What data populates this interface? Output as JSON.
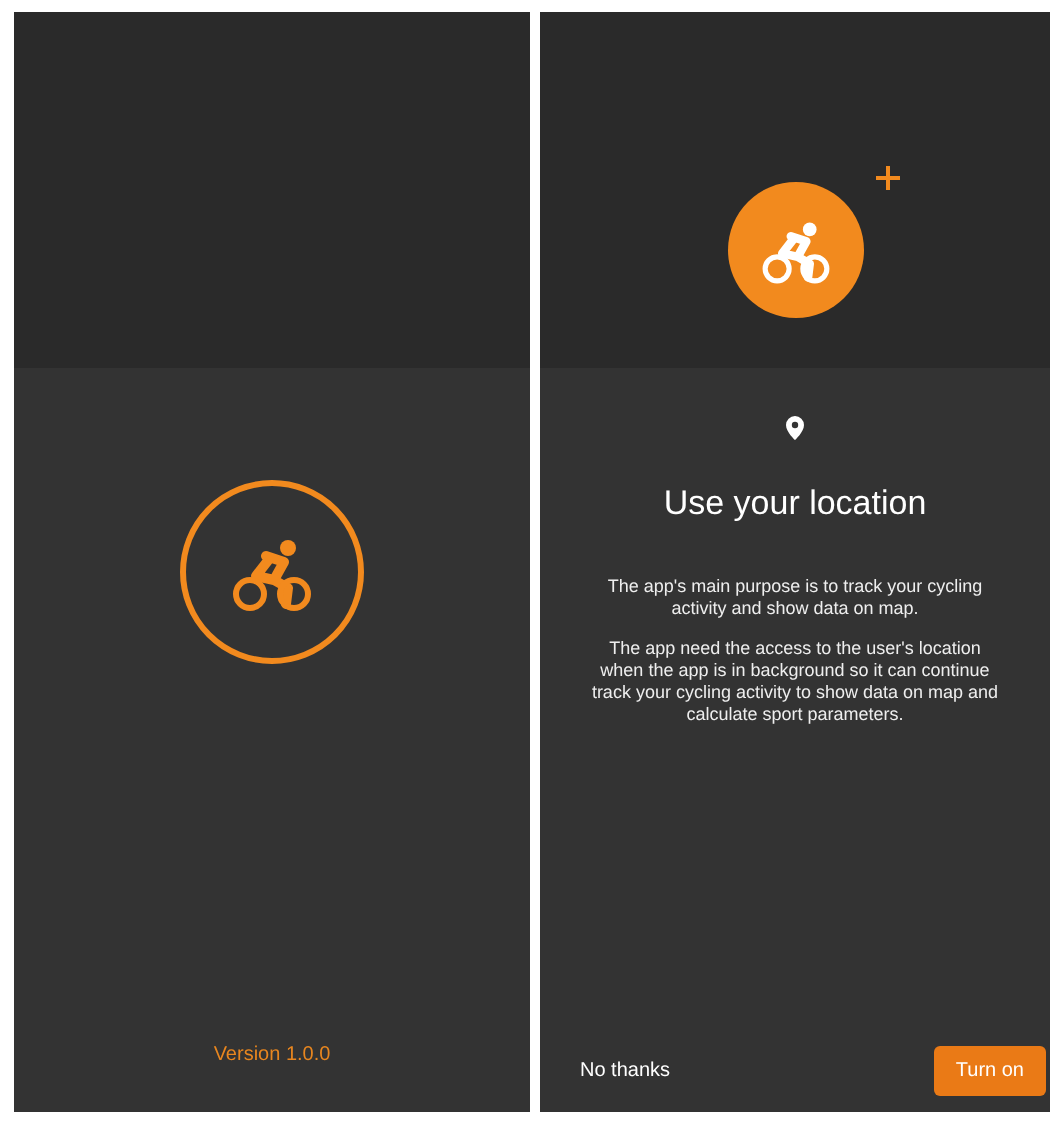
{
  "splash": {
    "version": "Version 1.0.0"
  },
  "permission": {
    "title": "Use your location",
    "paragraphs": [
      "The app's main purpose is to track your cycling activity and show data on map.",
      "The app need the access to the user's location when the app is in background so it can continue track your cycling activity to show data on map and calculate sport parameters."
    ],
    "buttons": [
      {
        "label": "No thanks",
        "kind": "text"
      },
      {
        "label": "Turn on",
        "kind": "filled"
      }
    ]
  }
}
